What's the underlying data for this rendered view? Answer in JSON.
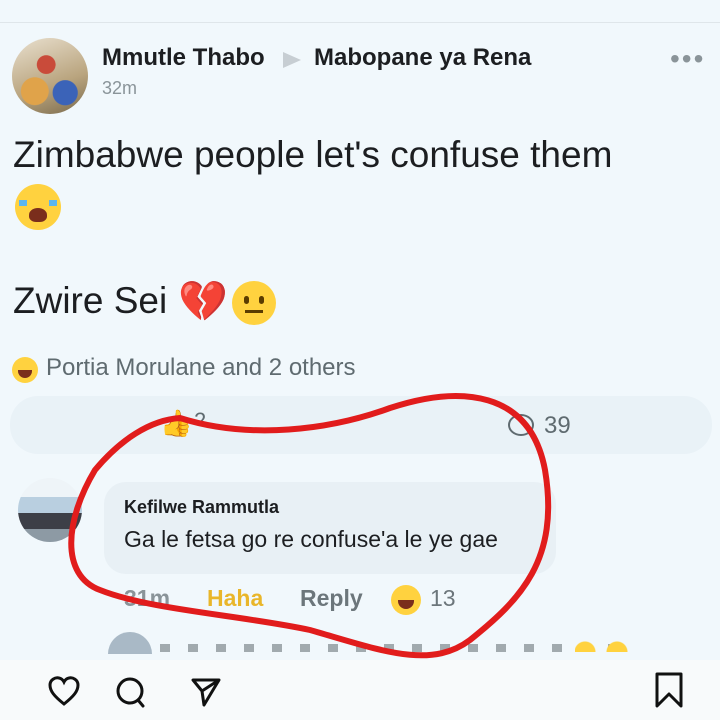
{
  "post": {
    "author": "Mmutle Thabo",
    "group": "Mabopane ya Rena",
    "time": "32m",
    "line1": "Zimbabwe people let's confuse them",
    "line2": "Zwire Sei",
    "more_label": "•••"
  },
  "reactions": {
    "summary": "Portia Morulane and 2 others",
    "like_count": "2",
    "comment_count": "39"
  },
  "comment": {
    "author": "Kefilwe Rammutla",
    "text": "Ga le fetsa go re confuse'a le ye gae",
    "time": "31m",
    "haha_label": "Haha",
    "reply_label": "Reply",
    "reaction_count": "13"
  },
  "icons": {
    "cry": "loudly-crying-face-emoji",
    "heart": "broken-heart-emoji",
    "neutral": "neutral-face-emoji",
    "haha": "laughing-face-emoji",
    "like": "thumbs-up-icon",
    "comment": "comment-bubble-icon",
    "nav": [
      "heart-icon",
      "comment-icon",
      "share-icon",
      "bookmark-icon"
    ]
  },
  "colors": {
    "background": "#f1f8fc",
    "annotation_red": "#e11c1c",
    "haha_gold": "#e9b62a"
  }
}
